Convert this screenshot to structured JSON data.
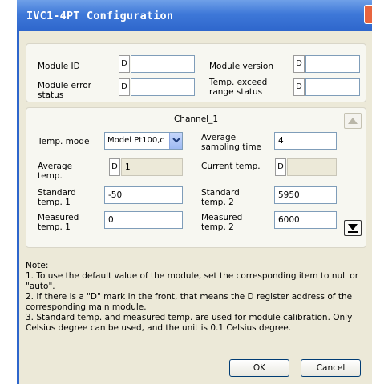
{
  "window": {
    "title": "IVC1-4PT Configuration"
  },
  "module": {
    "id_label": "Module ID",
    "id_prefix": "D",
    "id_value": "",
    "version_label": "Module version",
    "version_prefix": "D",
    "version_value": "",
    "error_label": "Module error status",
    "error_prefix": "D",
    "error_value": "",
    "exceed_label": "Temp. exceed range status",
    "exceed_prefix": "D",
    "exceed_value": ""
  },
  "channel": {
    "title": "Channel_1",
    "temp_mode_label": "Temp. mode",
    "temp_mode_value": "Model Pt100,c",
    "avg_sampling_label": "Average sampling time",
    "avg_sampling_value": "4",
    "avg_temp_label": "Average temp.",
    "avg_temp_prefix": "D",
    "avg_temp_value": "1",
    "current_temp_label": "Current temp.",
    "current_temp_prefix": "D",
    "current_temp_value": "",
    "std1_label": "Standard temp. 1",
    "std1_value": "-50",
    "std2_label": "Standard temp. 2",
    "std2_value": "5950",
    "meas1_label": "Measured temp. 1",
    "meas1_value": "0",
    "meas2_label": "Measured temp. 2",
    "meas2_value": "6000"
  },
  "notes": [
    "Note:",
    "1. To use the default value of the module, set the corresponding item to null or \"auto\".",
    "2. If there is a \"D\" mark in the front, that means the D register address of the corresponding main module.",
    "3. Standard temp. and measured temp. are used for module calibration. Only Celsius degree can be used, and the unit is 0.1 Celsius degree."
  ],
  "buttons": {
    "ok": "OK",
    "cancel": "Cancel"
  }
}
